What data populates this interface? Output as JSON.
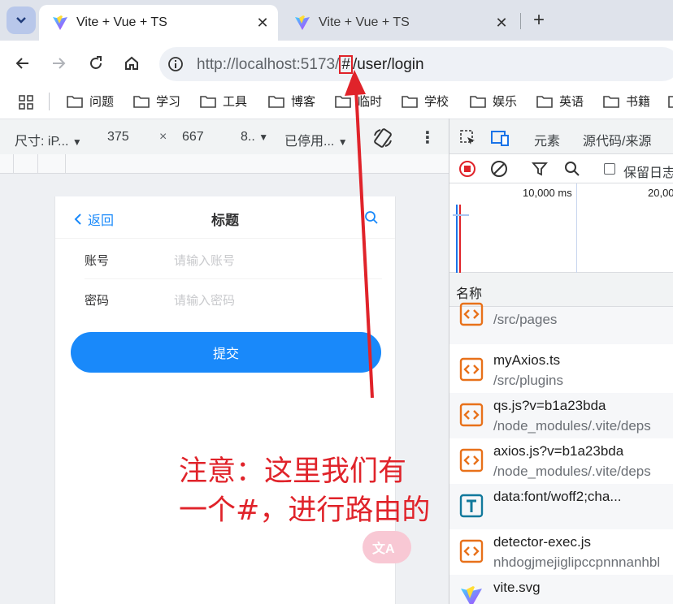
{
  "browser": {
    "tabs": [
      {
        "title": "Vite + Vue + TS",
        "active": true
      },
      {
        "title": "Vite + Vue + TS",
        "active": false
      }
    ],
    "new_tab": "+",
    "close_glyph": "✕",
    "url_host": "http://localhost",
    "url_port": ":5173/",
    "url_hash": "#",
    "url_path": "/user/login",
    "bookmarks": [
      "问题",
      "学习",
      "工具",
      "博客",
      "临时",
      "学校",
      "娱乐",
      "英语",
      "书籍"
    ]
  },
  "device_toolbar": {
    "dimensions_label": "尺寸: iP...",
    "width": "375",
    "times": "×",
    "height": "667",
    "zoom": "8..",
    "throttling": "已停用..."
  },
  "app": {
    "back_label": "返回",
    "title": "标题",
    "account_label": "账号",
    "account_placeholder": "请输入账号",
    "password_label": "密码",
    "password_placeholder": "请输入密码",
    "submit_label": "提交",
    "translate_fab": "文A"
  },
  "devtools": {
    "tab_elements": "元素",
    "tab_sources": "源代码/来源",
    "preserve_log": "保留日志",
    "timeline_marks": [
      "10,000 ms",
      "20,00"
    ],
    "name_header": "名称",
    "requests": [
      {
        "name": "",
        "path": "/src/pages",
        "icon": "code-icon"
      },
      {
        "name": "myAxios.ts",
        "path": "/src/plugins",
        "icon": "code-icon"
      },
      {
        "name": "qs.js?v=b1a23bda",
        "path": "/node_modules/.vite/deps",
        "icon": "code-icon"
      },
      {
        "name": "axios.js?v=b1a23bda",
        "path": "/node_modules/.vite/deps",
        "icon": "code-icon"
      },
      {
        "name": "data:font/woff2;cha...",
        "path": "",
        "icon": "font-icon"
      },
      {
        "name": "detector-exec.js",
        "path": "nhdogjmejiglipccpnnnanhbl",
        "icon": "code-icon"
      },
      {
        "name": "vite.svg",
        "path": "",
        "icon": "vite-icon"
      }
    ]
  },
  "annotation": {
    "line1": "注意：这里我们有",
    "line2": "一个#，进行路由的"
  },
  "colors": {
    "accent": "#1989fa",
    "annotation": "#e0232a",
    "devtools_icon": "#e8711a"
  }
}
